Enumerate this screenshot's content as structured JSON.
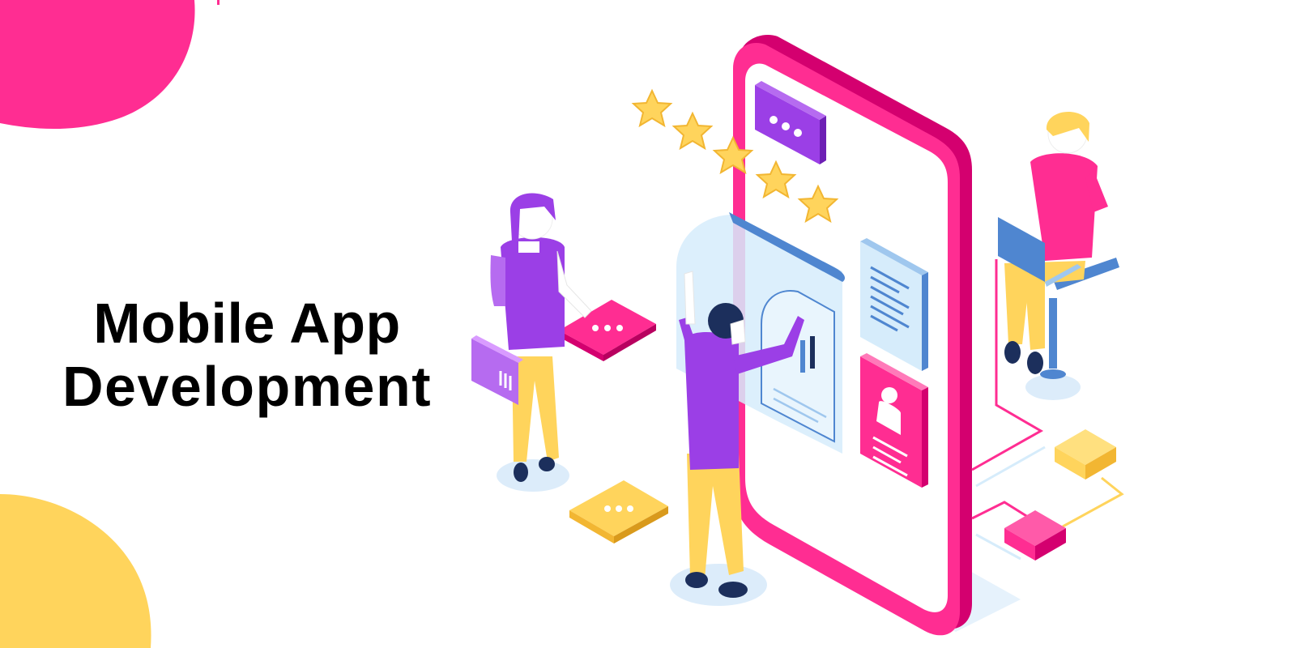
{
  "heading": {
    "line1": "Mobile App",
    "line2": "Development"
  },
  "colors": {
    "pink": "#ff2d92",
    "pink_dark": "#d4006f",
    "yellow": "#ffd45c",
    "yellow_dark": "#f2b632",
    "purple": "#9b3fe6",
    "purple_light": "#b66bf0",
    "blue": "#4f86d0",
    "blue_light": "#d6ecfb",
    "navy": "#1c2f5c",
    "skin": "#ffffff"
  },
  "rating": {
    "stars": 5,
    "max": 5
  }
}
